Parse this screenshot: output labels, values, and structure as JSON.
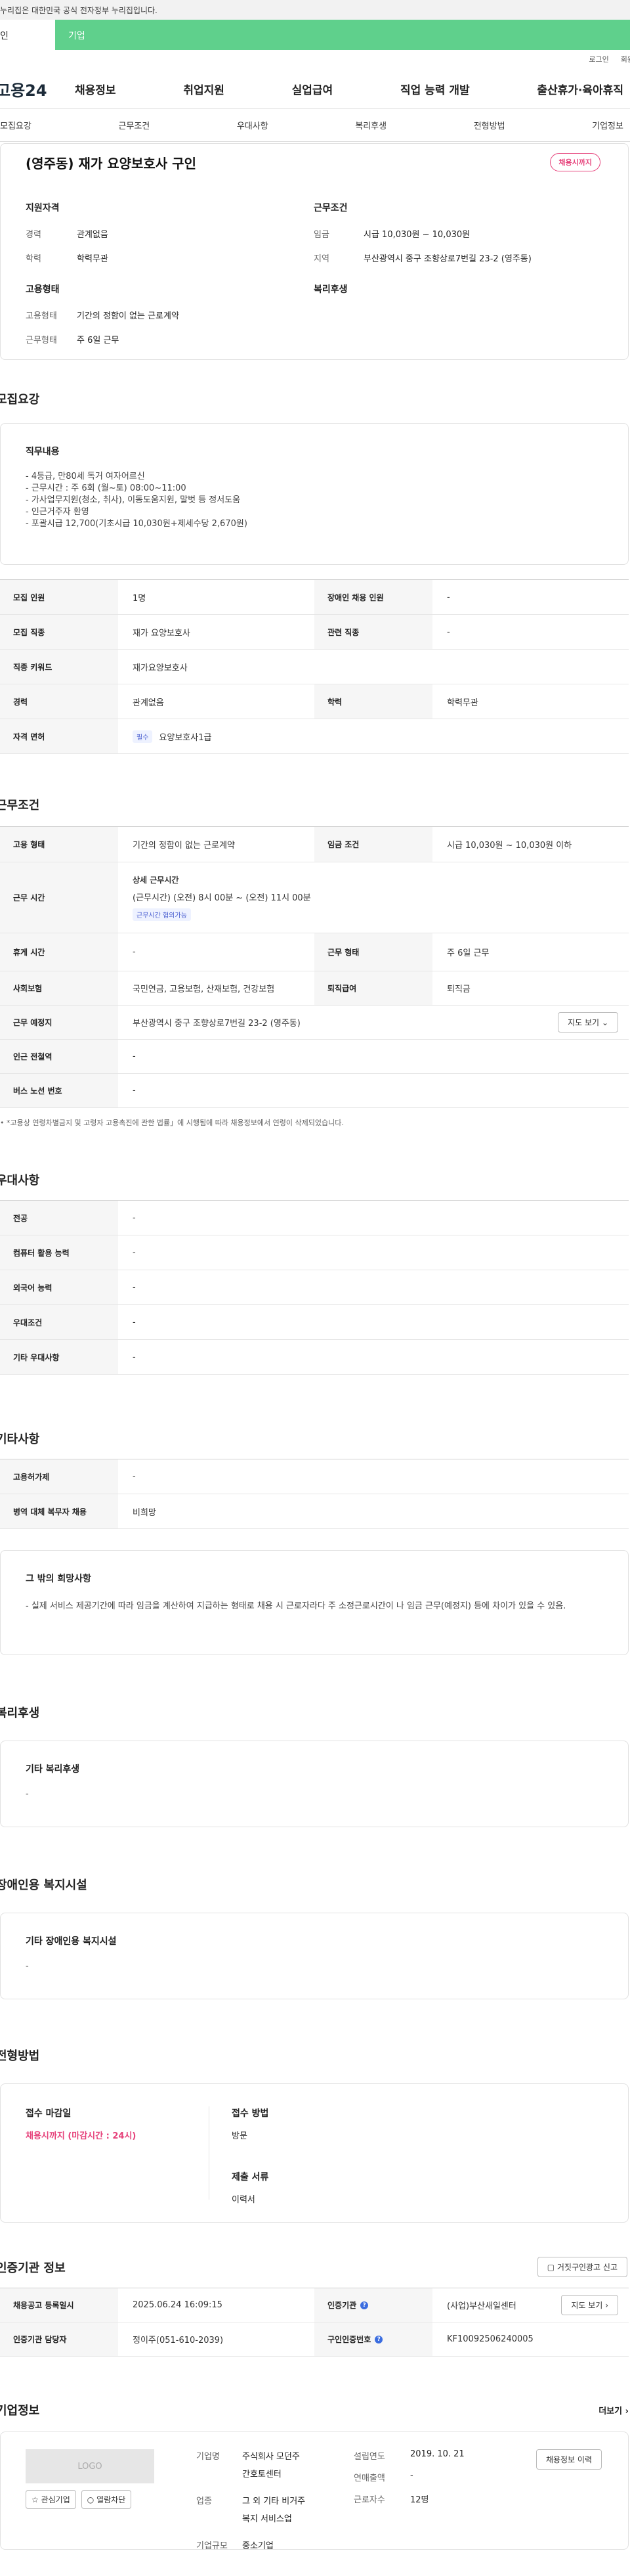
{
  "gov_banner": "누리집은 대한민국 공식 전자정부 누리집입니다.",
  "tabs": {
    "personal": "인",
    "enterprise": "기업"
  },
  "util": {
    "login": "로그인",
    "join": "회원"
  },
  "logo": "고용24",
  "gnb": [
    "채용정보",
    "취업지원",
    "실업급여",
    "직업 능력 개발",
    "출산휴가·육아휴직"
  ],
  "snb": [
    "모집요강",
    "근무조건",
    "우대사항",
    "복리후생",
    "전형방법",
    "기업정보"
  ],
  "summary": {
    "title": "(영주동) 재가 요양보호사 구인",
    "deadline_badge": "채용시까지",
    "qual_h": "지원자격",
    "career_k": "경력",
    "career_v": "관계없음",
    "edu_k": "학력",
    "edu_v": "학력무관",
    "cond_h": "근무조건",
    "wage_k": "임금",
    "wage_v": "시급 10,030원 ~ 10,030원",
    "area_k": "지역",
    "area_v": "부산광역시 중구 조향상로7번길 23-2 (영주동)",
    "type_h": "고용형태",
    "type_k": "고용형태",
    "type_v": "기간의 정함이 없는 근로계약",
    "form_k": "근무형태",
    "form_v": "주 6일 근무",
    "welfare_h": "복리후생"
  },
  "recruit": {
    "h": "모집요강",
    "job_h": "직무내용",
    "job_lines": [
      "- 4등급, 만80세 독거 여자어르신",
      "- 근무시간 : 주 6회 (월~토)  08:00~11:00",
      "- 가사업무지원(청소, 취사), 이동도움지원, 말벗 등 정서도움",
      "- 인근거주자 환영",
      "- 포괄시급 12,700(기초시급 10,030원+제세수당 2,670원)"
    ],
    "rows": [
      [
        "모집 인원",
        "1명",
        "장애인 채용 인원",
        "-"
      ],
      [
        "모집 직종",
        "재가 요양보호사",
        "관련 직종",
        "-"
      ]
    ],
    "kw_k": "직종 키워드",
    "kw_v": "재가요양보호사",
    "career_k": "경력",
    "career_v": "관계없음",
    "edu_k": "학력",
    "edu_v": "학력무관",
    "lic_k": "자격 면허",
    "lic_tag": "필수",
    "lic_v": "요양보호사1급"
  },
  "work": {
    "h": "근무조건",
    "emp_k": "고용 형태",
    "emp_v": "기간의 정함이 없는 근로계약",
    "wage_k": "임금 조건",
    "wage_v": "시급 10,030원 ~ 10,030원 이하",
    "time_k": "근무 시간",
    "time_h": "상세 근무시간",
    "time_v": "(근무시간) (오전) 8시 00분 ~ (오전) 11시 00분",
    "time_tag": "근무시간 협의가능",
    "rest_k": "휴게 시간",
    "rest_v": "-",
    "form_k": "근무 형태",
    "form_v": "주 6일 근무",
    "ins_k": "사회보험",
    "ins_v": "국민연금, 고용보험, 산재보험, 건강보험",
    "ret_k": "퇴직급여",
    "ret_v": "퇴직금",
    "place_k": "근무 예정지",
    "place_v": "부산광역시 중구 조향상로7번길 23-2 (영주동)",
    "map_btn": "지도 보기",
    "sub_k": "인근 전철역",
    "sub_v": "-",
    "bus_k": "버스 노선 번호",
    "bus_v": "-",
    "note": "• *고용상 연령차별금지 및 고령자 고용촉진에 관한 법률」에 시행됨에 따라 채용정보에서 연령이 삭제되었습니다."
  },
  "pref": {
    "h": "우대사항",
    "rows": [
      [
        "전공",
        "-"
      ],
      [
        "컴퓨터 활용 능력",
        "-"
      ],
      [
        "외국어 능력",
        "-"
      ],
      [
        "우대조건",
        "-"
      ],
      [
        "기타 우대사항",
        "-"
      ]
    ]
  },
  "etc": {
    "h": "기타사항",
    "rows": [
      [
        "고용허가제",
        "-"
      ],
      [
        "병역 대체 복무자 채용",
        "비희망"
      ]
    ],
    "other_h": "그 밖의 희망사항",
    "other_v": "- 실제 서비스 제공기간에 따라 임금을 계산하여 지급하는 형태로 채용 시 근로자라다 주 소정근로시간이  나 임금 근무(예정지) 등에 차이가 있을 수 있음."
  },
  "welfare": {
    "h": "복리후생",
    "box_h": "기타 복리후생",
    "box_v": "-"
  },
  "disab": {
    "h": "장애인용 복지시설",
    "box_h": "기타 장애인용 복지시설",
    "box_v": "-"
  },
  "select": {
    "h": "전형방법",
    "deadline_k": "접수 마감일",
    "deadline_v": "채용시까지 (마감시간 : 24시)",
    "method_k": "접수 방법",
    "method_v": "방문",
    "doc_k": "제출 서류",
    "doc_v": "이력서"
  },
  "cert": {
    "h": "인증기관 정보",
    "report_btn": "거짓구인광고 신고",
    "reg_k": "채용공고 등록일시",
    "reg_v": "2025.06.24 16:09:15",
    "org_k": "인증기관",
    "org_v": "(사업)부산새일센터",
    "map_btn": "지도 보기",
    "mgr_k": "인증기관 담당자",
    "mgr_v": "정이주(051-610-2039)",
    "num_k": "구인인증번호",
    "num_v": "KF10092506240005"
  },
  "company": {
    "h": "기업정보",
    "more": "더보기",
    "logo": "LOGO",
    "fav_btn": "관심기업",
    "block_btn": "열람차단",
    "name_k": "기업명",
    "name_v1": "주식회사 모던주",
    "name_v2": "간호토센터",
    "est_k": "설립연도",
    "est_v": "2019. 10. 21",
    "hist_btn": "채용정보 이력",
    "ind_k": "업종",
    "ind_v1": "그 외 기타 비거주",
    "ind_v2": "복지 서비스업",
    "sales_k": "연매출액",
    "sales_v": "-",
    "emp_k": "근로자수",
    "emp_v": "12명",
    "size_k": "기업규모",
    "size_v": "중소기업"
  }
}
